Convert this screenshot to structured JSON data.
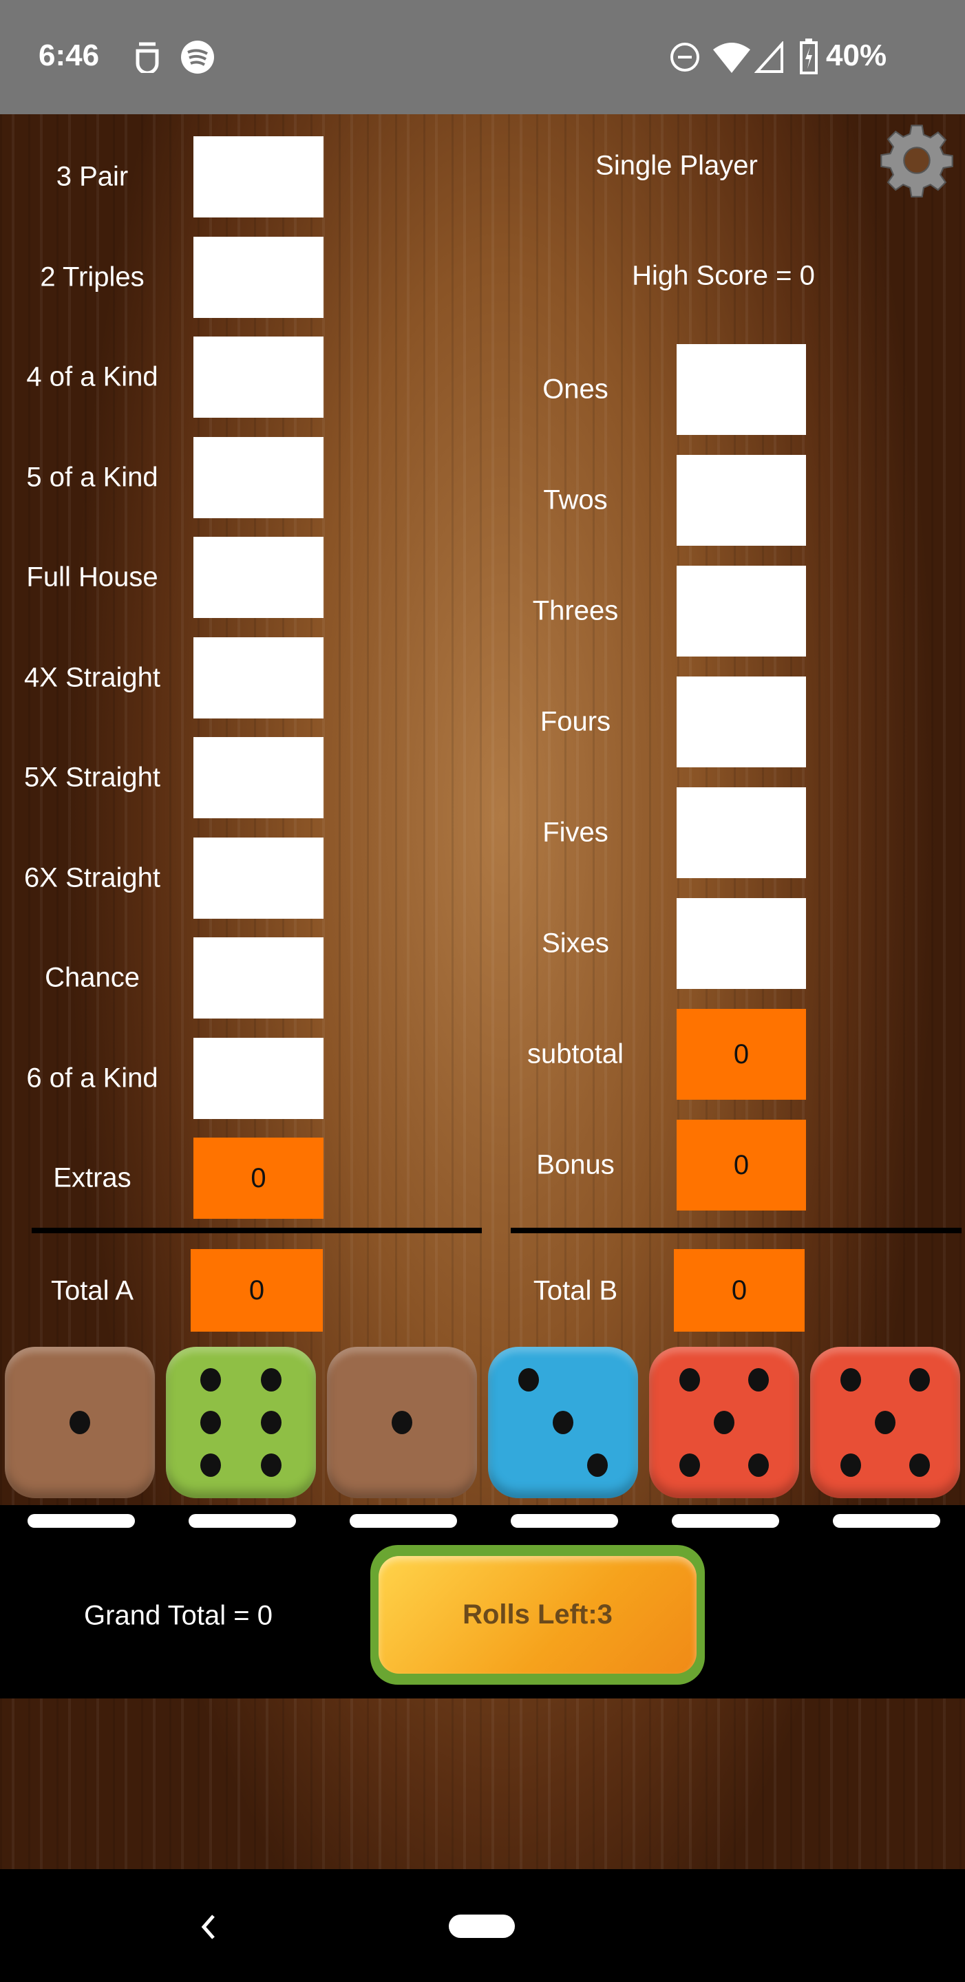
{
  "status_bar": {
    "time": "6:46",
    "battery": "40%",
    "icons": [
      "notification-icon",
      "spotify-icon",
      "dnd-icon",
      "wifi-icon",
      "signal-icon",
      "battery-charging-icon"
    ]
  },
  "header": {
    "mode": "Single Player",
    "high_score": "High Score = 0"
  },
  "left_categories": [
    {
      "label": "3 Pair",
      "value": ""
    },
    {
      "label": "2 Triples",
      "value": ""
    },
    {
      "label": "4 of a Kind",
      "value": ""
    },
    {
      "label": "5 of a Kind",
      "value": ""
    },
    {
      "label": "Full House",
      "value": ""
    },
    {
      "label": "4X Straight",
      "value": ""
    },
    {
      "label": "5X Straight",
      "value": ""
    },
    {
      "label": "6X Straight",
      "value": ""
    },
    {
      "label": "Chance",
      "value": ""
    },
    {
      "label": "6 of a Kind",
      "value": ""
    }
  ],
  "extras": {
    "label": "Extras",
    "value": "0"
  },
  "right_categories": [
    {
      "label": "Ones",
      "value": ""
    },
    {
      "label": "Twos",
      "value": ""
    },
    {
      "label": "Threes",
      "value": ""
    },
    {
      "label": "Fours",
      "value": ""
    },
    {
      "label": "Fives",
      "value": ""
    },
    {
      "label": "Sixes",
      "value": ""
    }
  ],
  "subtotal": {
    "label": "subtotal",
    "value": "0"
  },
  "bonus": {
    "label": "Bonus",
    "value": "0"
  },
  "total_a": {
    "label": "Total A",
    "value": "0"
  },
  "total_b": {
    "label": "Total B",
    "value": "0"
  },
  "dice": [
    {
      "value": 1,
      "color": "#9b6a4b"
    },
    {
      "value": 6,
      "color": "#8fbf45"
    },
    {
      "value": 1,
      "color": "#9b6a4b"
    },
    {
      "value": 3,
      "color": "#33a9dc"
    },
    {
      "value": 5,
      "color": "#e84f36"
    },
    {
      "value": 5,
      "color": "#e84f36"
    }
  ],
  "grand_total": "Grand Total = 0",
  "roll_button": "Rolls Left:3",
  "colors": {
    "score_box": "#ff7300",
    "status_bar": "#767676"
  }
}
